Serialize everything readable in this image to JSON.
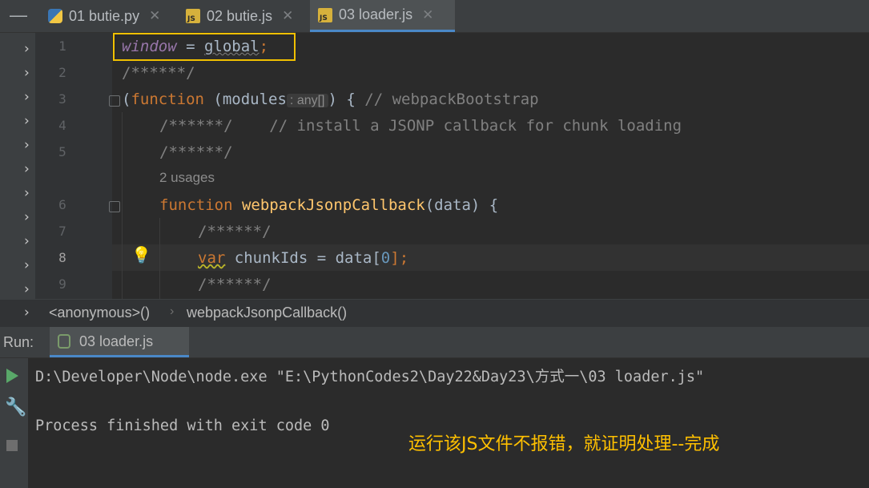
{
  "tabs": [
    {
      "label": "01 butie.py",
      "icon": "python-file-icon"
    },
    {
      "label": "02 butie.js",
      "icon": "js-file-icon"
    },
    {
      "label": "03 loader.js",
      "icon": "js-file-icon",
      "active": true
    }
  ],
  "editor": {
    "line_numbers": [
      "1",
      "2",
      "3",
      "4",
      "5",
      "6",
      "7",
      "8",
      "9"
    ],
    "lines": {
      "l1_global_obj": "window",
      "l1_op": " = ",
      "l1_value": "global",
      "l1_semi": ";",
      "l2": "/******/",
      "l3_paren": "(",
      "l3_kw": "function",
      "l3_param": " (modules",
      "l3_hint": ": any[]",
      "l3_rest": ") { ",
      "l3_comment": "// webpackBootstrap",
      "l4_code": "/******/",
      "l4_comment": "    // install a JSONP callback for chunk loading",
      "l5": "/******/",
      "usages": "2 usages",
      "l6_kw": "function",
      "l6_fn": " webpackJsonpCallback",
      "l6_rest": "(data) {",
      "l7": "/******/",
      "l8_kw": "var",
      "l8_mid": " chunkIds = data[",
      "l8_num": "0",
      "l8_end": "];",
      "l9": "/******/"
    }
  },
  "breadcrumb": {
    "items": [
      "<anonymous>()",
      "webpackJsonpCallback()"
    ],
    "separator": "›"
  },
  "run": {
    "label": "Run:",
    "tab_label": "03 loader.js",
    "console_line1": "D:\\Developer\\Node\\node.exe \"E:\\PythonCodes2\\Day22&Day23\\方式一\\03 loader.js\"",
    "console_line2": "Process finished with exit code 0"
  },
  "annotation": "运行该JS文件不报错，就证明处理--完成",
  "colors": {
    "highlight_box": "#f0c000",
    "annotation": "#ffc000",
    "keyword": "#cc7832",
    "function": "#ffc66d",
    "comment": "#808080"
  }
}
